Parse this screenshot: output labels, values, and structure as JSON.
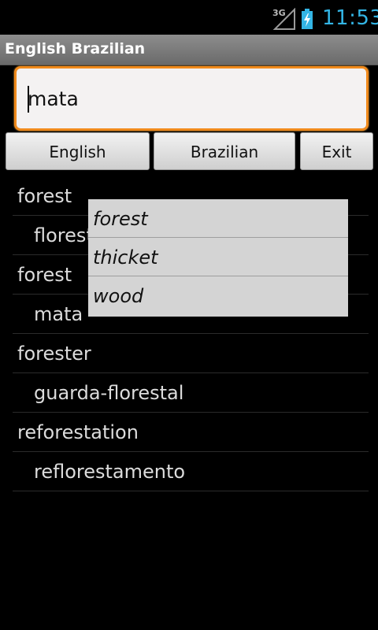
{
  "status": {
    "network": "3G",
    "time": "11:53",
    "colors": {
      "clock": "#33b5e5"
    }
  },
  "app": {
    "title": "English Brazilian"
  },
  "search": {
    "value": "mata"
  },
  "buttons": {
    "english": "English",
    "brazilian": "Brazilian",
    "exit": "Exit"
  },
  "results": [
    {
      "word": "forest",
      "translation": "floresta"
    },
    {
      "word": "forest",
      "translation": "mata"
    },
    {
      "word": "forester",
      "translation": "guarda-florestal"
    },
    {
      "word": "reforestation",
      "translation": "reflorestamento"
    }
  ],
  "popup": {
    "items": [
      "forest",
      "thicket",
      "wood"
    ]
  },
  "colors": {
    "accent": "#f08a1c"
  }
}
